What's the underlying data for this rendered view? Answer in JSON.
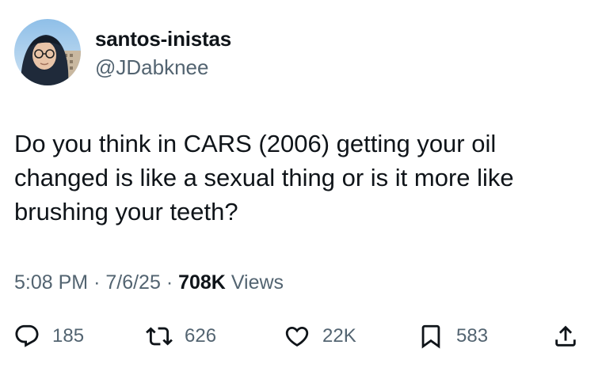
{
  "author": {
    "display_name": "santos-inistas",
    "handle": "@JDabknee"
  },
  "tweet": {
    "text": "Do you think in CARS (2006) getting your oil changed is like a sexual thing or is it more like brushing your teeth?"
  },
  "meta": {
    "time": "5:08 PM",
    "separator": "·",
    "date": "7/6/25",
    "views_count": "708K",
    "views_label": "Views"
  },
  "actions": {
    "replies": "185",
    "retweets": "626",
    "likes": "22K",
    "bookmarks": "583"
  },
  "colors": {
    "text": "#0f1419",
    "secondary": "#536471",
    "background": "#ffffff"
  }
}
